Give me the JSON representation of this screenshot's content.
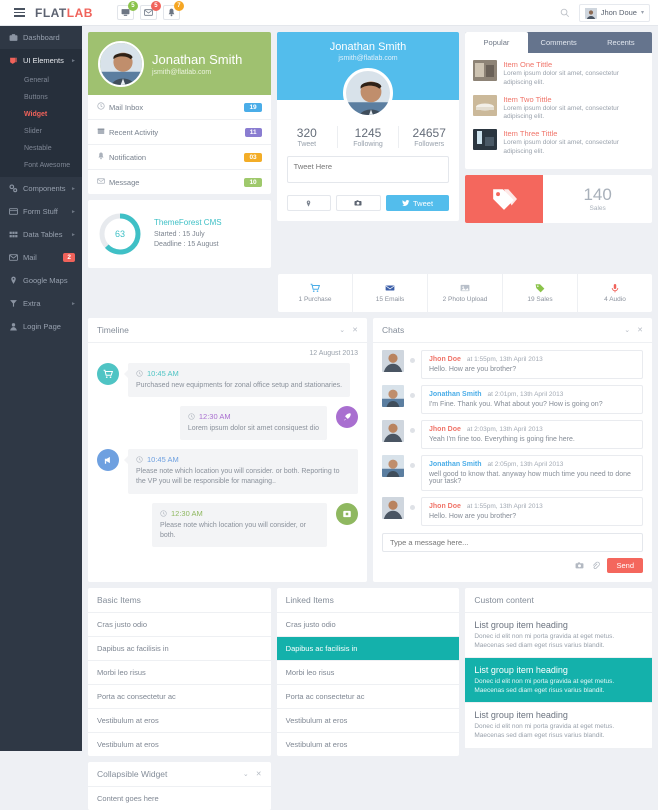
{
  "header": {
    "logo_flat": "FLAT",
    "logo_lab": "LAB",
    "icons": [
      {
        "name": "desktop-icon",
        "badge": "5",
        "color": "#8bc34a"
      },
      {
        "name": "envelope-icon",
        "badge": "5",
        "color": "#f0625a"
      },
      {
        "name": "bell-icon",
        "badge": "7",
        "color": "#f5a623"
      }
    ],
    "user_name": "Jhon Doue",
    "caret": "▾"
  },
  "sidebar": {
    "items": [
      {
        "label": "Dashboard",
        "icon": "dashboard-icon",
        "arrow": "",
        "badge": ""
      },
      {
        "label": "UI Elements",
        "icon": "ui-elements-icon",
        "arrow": "►",
        "badge": ""
      },
      {
        "label": "Components",
        "icon": "components-icon",
        "arrow": "►",
        "badge": ""
      },
      {
        "label": "Form Stuff",
        "icon": "form-icon",
        "arrow": "►",
        "badge": ""
      },
      {
        "label": "Data Tables",
        "icon": "table-icon",
        "arrow": "►",
        "badge": ""
      },
      {
        "label": "Mail",
        "icon": "mail-icon",
        "arrow": "",
        "badge": "2"
      },
      {
        "label": "Google Maps",
        "icon": "map-pin-icon",
        "arrow": "",
        "badge": ""
      },
      {
        "label": "Extra",
        "icon": "extra-icon",
        "arrow": "►",
        "badge": ""
      },
      {
        "label": "Login Page",
        "icon": "user-icon",
        "arrow": "",
        "badge": ""
      }
    ],
    "sub_items": [
      {
        "label": "General"
      },
      {
        "label": "Buttons"
      },
      {
        "label": "Widget"
      },
      {
        "label": "Slider"
      },
      {
        "label": "Nestable"
      },
      {
        "label": "Font Awesome"
      }
    ]
  },
  "profile": {
    "name": "Jonathan Smith",
    "email": "jsmith@flatlab.com",
    "rows": [
      {
        "label": "Mail Inbox",
        "icon": "clock-icon",
        "badge": "19",
        "color": "#4aade8"
      },
      {
        "label": "Recent Activity",
        "icon": "calendar-icon",
        "badge": "11",
        "color": "#8a7dd1"
      },
      {
        "label": "Notification",
        "icon": "bell-icon",
        "badge": "03",
        "color": "#f3ad27"
      },
      {
        "label": "Message",
        "icon": "envelope-icon",
        "badge": "10",
        "color": "#9fc96c"
      }
    ]
  },
  "progress": {
    "value": "63",
    "percent": 63,
    "title": "ThemeForest CMS",
    "started": "Started : 15 July",
    "deadline": "Deadline : 15 August",
    "color": "#3fc0c6"
  },
  "twitter": {
    "name": "Jonathan Smith",
    "email": "jsmith@flatlab.com",
    "stats": [
      {
        "value": "320",
        "label": "Tweet"
      },
      {
        "value": "1245",
        "label": "Following"
      },
      {
        "value": "24657",
        "label": "Followers"
      }
    ],
    "placeholder": "Tweet Here",
    "tweet_button": "Tweet",
    "location_icon": "map-pin-icon",
    "camera_icon": "camera-icon"
  },
  "tabs_panel": {
    "tabs": [
      {
        "label": "Popular",
        "active": true
      },
      {
        "label": "Comments",
        "active": false
      },
      {
        "label": "Recents",
        "active": false
      }
    ],
    "items": [
      {
        "title": "Item One Tittle",
        "desc": "Lorem ipsum dolor sit amet, consectetur adipiscing elit.",
        "thumb": "#6e7a86"
      },
      {
        "title": "Item Two Tittle",
        "desc": "Lorem ipsum dolor sit amet, consectetur adipiscing elit.",
        "thumb": "#c0a87d"
      },
      {
        "title": "Item Three Tittle",
        "desc": "Lorem ipsum dolor sit amet, consectetur adipiscing elit.",
        "thumb": "#3b4a5a"
      }
    ]
  },
  "sales": {
    "icon": "tags-icon",
    "value": "140",
    "label": "Sales",
    "color": "#f4675d"
  },
  "strip": [
    {
      "label": "1 Purchase",
      "icon": "cart-icon",
      "color": "#4aade8"
    },
    {
      "label": "15 Emails",
      "icon": "envelope-icon",
      "color": "#3b5ea8"
    },
    {
      "label": "2 Photo Upload",
      "icon": "image-icon",
      "color": "#9aa2ac"
    },
    {
      "label": "19 Sales",
      "icon": "tag-icon",
      "color": "#8bc34a"
    },
    {
      "label": "4 Audio",
      "icon": "microphone-icon",
      "color": "#f0625a"
    }
  ],
  "timeline": {
    "title": "Timeline",
    "date": "12 August 2013",
    "collapse_icon": "chevron-down-icon",
    "close_icon": "close-icon",
    "entries": [
      {
        "side": "left",
        "icon": "cart-icon",
        "color": "#4fc4c4",
        "time": "10:45 AM",
        "text": "Purchased new equipments for zonal office setup and stationaries."
      },
      {
        "side": "right",
        "icon": "rocket-icon",
        "color": "#a96fd0",
        "time": "12:30 AM",
        "text": "Lorem ipsum dolor sit amet consiquest dio"
      },
      {
        "side": "left",
        "icon": "megaphone-icon",
        "color": "#6ea0e0",
        "time": "10:45 AM",
        "text": "Please note which location you will consider. or both. Reporting to the VP you will be responsible for managing.."
      },
      {
        "side": "right",
        "icon": "archive-icon",
        "color": "#8fb860",
        "time": "12:30 AM",
        "text": "Please note which location you will consider, or both."
      }
    ]
  },
  "chats": {
    "title": "Chats",
    "collapse_icon": "chevron-down-icon",
    "close_icon": "close-icon",
    "messages": [
      {
        "who": "Jhon Doe",
        "color": "#f0756a",
        "when": "at 1:55pm, 13th April 2013",
        "msg": "Hello. How are you brother?"
      },
      {
        "who": "Jonathan Smith",
        "color": "#4aade8",
        "when": "at 2:01pm, 13th April 2013",
        "msg": "I'm Fine. Thank you. What about you? How is going on?"
      },
      {
        "who": "Jhon Doe",
        "color": "#f0756a",
        "when": "at 2:03pm, 13th April 2013",
        "msg": "Yeah I'm fine too. Everything is going fine here."
      },
      {
        "who": "Jonathan Smith",
        "color": "#4aade8",
        "when": "at 2:05pm, 13th April 2013",
        "msg": "well good to know that. anyway how much time you need to done your task?"
      },
      {
        "who": "Jhon Doe",
        "color": "#f0756a",
        "when": "at 1:55pm, 13th April 2013",
        "msg": "Hello. How are you brother?"
      }
    ],
    "placeholder": "Type a message here...",
    "send_label": "Send",
    "camera_icon": "camera-icon",
    "attach_icon": "paperclip-icon"
  },
  "basic_items": {
    "title": "Basic Items",
    "items": [
      {
        "label": "Cras justo odio",
        "active": false
      },
      {
        "label": "Dapibus ac facilisis in",
        "active": false
      },
      {
        "label": "Morbi leo risus",
        "active": false
      },
      {
        "label": "Porta ac consectetur ac",
        "active": false
      },
      {
        "label": "Vestibulum at eros",
        "active": false
      },
      {
        "label": "Vestibulum at eros",
        "active": false
      }
    ]
  },
  "linked_items": {
    "title": "Linked Items",
    "items": [
      {
        "label": "Cras justo odio",
        "active": false
      },
      {
        "label": "Dapibus ac facilisis in",
        "active": true
      },
      {
        "label": "Morbi leo risus",
        "active": false
      },
      {
        "label": "Porta ac consectetur ac",
        "active": false
      },
      {
        "label": "Vestibulum at eros",
        "active": false
      },
      {
        "label": "Vestibulum at eros",
        "active": false
      }
    ]
  },
  "custom_content": {
    "title": "Custom content",
    "items": [
      {
        "heading": "List group item heading",
        "desc": "Donec id elit non mi porta gravida at eget metus. Maecenas sed diam eget risus varius blandit.",
        "active": false
      },
      {
        "heading": "List group item heading",
        "desc": "Donec id elit non mi porta gravida at eget metus. Maecenas sed diam eget risus varius blandit.",
        "active": true
      },
      {
        "heading": "List group item heading",
        "desc": "Donec id elit non mi porta gravida at eget metus. Maecenas sed diam eget risus varius blandit.",
        "active": false
      }
    ]
  },
  "collapsible": {
    "title": "Collapsible Widget",
    "content": "Content goes here",
    "collapse_icon": "chevron-down-icon",
    "close_icon": "close-icon"
  }
}
